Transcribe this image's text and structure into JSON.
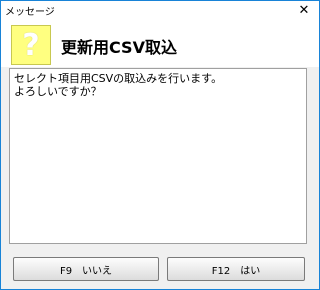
{
  "window": {
    "title": "メッセージ",
    "close_glyph": "✕"
  },
  "header": {
    "icon_glyph": "?",
    "title": "更新用CSV取込"
  },
  "message": {
    "text": "セレクト項目用CSVの取込みを行います。\nよろしいですか？"
  },
  "buttons": {
    "no_label": "F9　いいえ",
    "yes_label": "F12　はい"
  },
  "colors": {
    "icon_bg": "#ffff80",
    "border_accent": "#1883d7"
  }
}
